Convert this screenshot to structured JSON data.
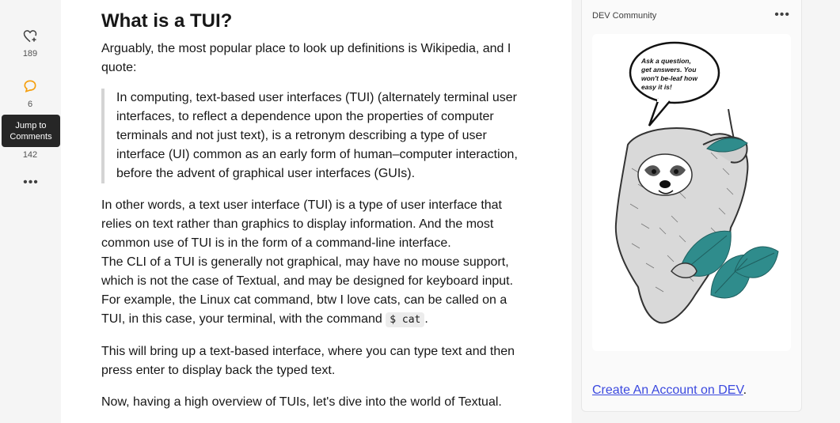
{
  "reactions": {
    "likes_count": "189",
    "comments_count": "6",
    "saves_count": "142",
    "tooltip": "Jump to Comments",
    "tooltip_line1": "Jump to",
    "tooltip_line2": "Comments"
  },
  "article": {
    "heading": "What is a TUI?",
    "intro": "Arguably, the most popular place to look up definitions is Wikipedia, and I quote:",
    "quote": "In computing, text-based user interfaces (TUI) (alternately terminal user interfaces, to reflect a dependence upon the properties of computer terminals and not just text), is a retronym describing a type of user interface (UI) common as an early form of human–computer interaction, before the advent of graphical user interfaces (GUIs).",
    "para1_line1": "In other words, a text user interface (TUI) is a type of user interface that relies on text rather than graphics to display information. And the most common use of TUI is in the form of a command-line interface.",
    "para1_line2": "The CLI of a TUI is generally not graphical, may have no mouse support, which is not the case of Textual, and may be designed for keyboard input. For example, the Linux cat command, btw I love cats, can be called on a TUI, in this case, your terminal, with the command ",
    "command": "$ cat",
    "para1_end": ".",
    "para2": "This will bring up a text-based interface, where you can type text and then press enter to display back the typed text.",
    "para3": "Now, having a high overview of TUIs, let's dive into the world of Textual."
  },
  "sidebar": {
    "community": "DEV Community",
    "bubble_text": "Ask a question, get answers. You won't be-leaf how easy it is!",
    "bubble_line1": "Ask a question,",
    "bubble_line2": "get answers. You",
    "bubble_line3": "won't be-leaf how",
    "bubble_line4": "easy it is!",
    "cta_link": "Create An Account on DEV",
    "cta_end": "."
  },
  "colors": {
    "link": "#3b49df",
    "leaf": "#2f8c8c",
    "tooltip_bg": "#262626"
  }
}
